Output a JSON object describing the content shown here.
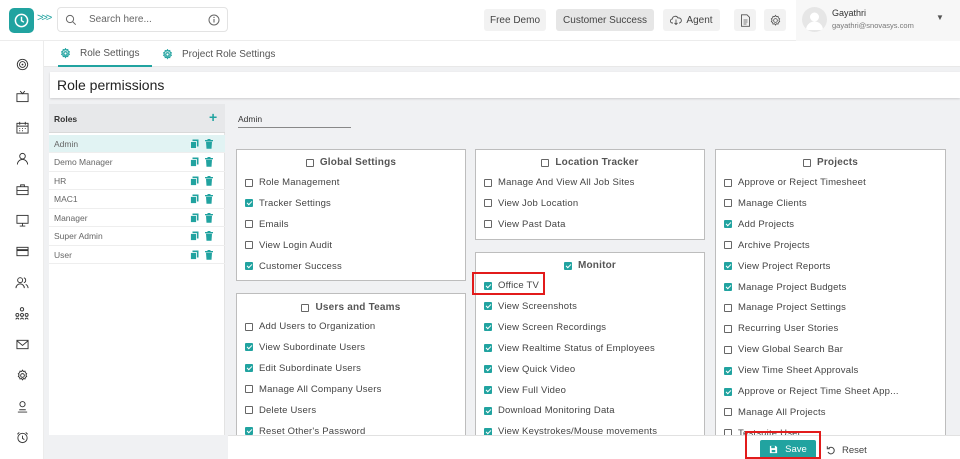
{
  "header": {
    "search_placeholder": "Search here...",
    "free_demo": "Free Demo",
    "customer_success": "Customer Success",
    "agent": "Agent",
    "user_name": "Gayathri",
    "user_email": "gayathri@snovasys.com"
  },
  "tabs": [
    {
      "label": "Role Settings",
      "active": true
    },
    {
      "label": "Project Role Settings",
      "active": false
    }
  ],
  "page_title": "Role permissions",
  "roles": {
    "header": "Roles",
    "add_label": "+",
    "items": [
      "Admin",
      "Demo Manager",
      "HR",
      "MAC1",
      "Manager",
      "Super Admin",
      "User"
    ],
    "selected": "Admin"
  },
  "role_name_value": "Admin",
  "panels": {
    "global_settings": {
      "title": "Global Settings",
      "checked": false,
      "items": [
        {
          "label": "Role Management",
          "checked": false
        },
        {
          "label": "Tracker Settings",
          "checked": true
        },
        {
          "label": "Emails",
          "checked": false
        },
        {
          "label": "View Login Audit",
          "checked": false
        },
        {
          "label": "Customer Success",
          "checked": true
        }
      ]
    },
    "users_and_teams": {
      "title": "Users and Teams",
      "checked": false,
      "items": [
        {
          "label": "Add Users to Organization",
          "checked": false
        },
        {
          "label": "View Subordinate Users",
          "checked": true
        },
        {
          "label": "Edit Subordinate Users",
          "checked": true
        },
        {
          "label": "Manage All Company Users",
          "checked": false
        },
        {
          "label": "Delete Users",
          "checked": false
        },
        {
          "label": "Reset Other's Password",
          "checked": true
        }
      ]
    },
    "location_tracker": {
      "title": "Location Tracker",
      "checked": false,
      "items": [
        {
          "label": "Manage And View All Job Sites",
          "checked": false
        },
        {
          "label": "View Job Location",
          "checked": false
        },
        {
          "label": "View Past Data",
          "checked": false
        }
      ]
    },
    "monitor": {
      "title": "Monitor",
      "checked": true,
      "items": [
        {
          "label": "Office TV",
          "checked": true
        },
        {
          "label": "View Screenshots",
          "checked": true
        },
        {
          "label": "View Screen Recordings",
          "checked": true
        },
        {
          "label": "View Realtime Status of Employees",
          "checked": true
        },
        {
          "label": "View Quick Video",
          "checked": true
        },
        {
          "label": "View Full Video",
          "checked": true
        },
        {
          "label": "Download Monitoring Data",
          "checked": true
        },
        {
          "label": "View Keystrokes/Mouse movements",
          "checked": true
        }
      ]
    },
    "projects": {
      "title": "Projects",
      "checked": false,
      "items": [
        {
          "label": "Approve or Reject Timesheet",
          "checked": false
        },
        {
          "label": "Manage Clients",
          "checked": false
        },
        {
          "label": "Add Projects",
          "checked": true
        },
        {
          "label": "Archive Projects",
          "checked": false
        },
        {
          "label": "View Project Reports",
          "checked": true
        },
        {
          "label": "Manage Project Budgets",
          "checked": true
        },
        {
          "label": "Manage Project Settings",
          "checked": false
        },
        {
          "label": "Recurring User Stories",
          "checked": false
        },
        {
          "label": "View Global Search Bar",
          "checked": false
        },
        {
          "label": "View Time Sheet Approvals",
          "checked": true
        },
        {
          "label": "Approve or Reject Time Sheet App...",
          "checked": true
        },
        {
          "label": "Manage All Projects",
          "checked": false
        },
        {
          "label": "Testsuite User",
          "checked": false
        }
      ]
    }
  },
  "footer": {
    "save": "Save",
    "reset": "Reset"
  },
  "colors": {
    "accent": "#21a3a0",
    "highlight": "#e21b1b",
    "delete_icon": "#21a3a0"
  }
}
